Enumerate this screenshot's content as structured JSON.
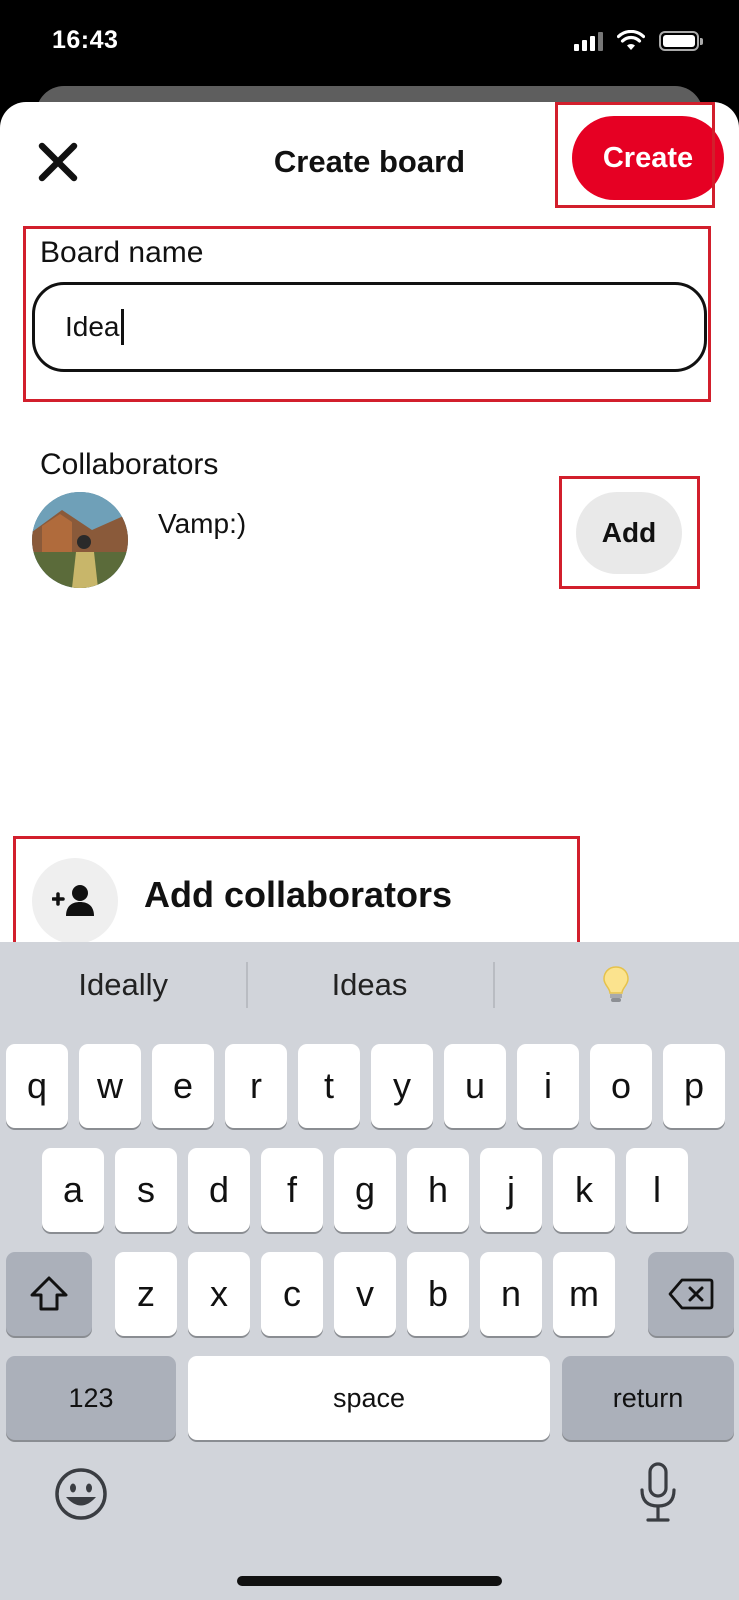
{
  "status_bar": {
    "time": "16:43"
  },
  "header": {
    "title": "Create board",
    "create_label": "Create"
  },
  "board_name": {
    "label": "Board name",
    "value": "Idea"
  },
  "collaborators": {
    "label": "Collaborators",
    "items": [
      {
        "name": "Vamp:)",
        "action_label": "Add"
      }
    ]
  },
  "add_collaborators": {
    "label": "Add collaborators"
  },
  "keyboard": {
    "suggestions": [
      "Ideally",
      "Ideas"
    ],
    "suggestion_icon": "lightbulb-icon",
    "row1": [
      "q",
      "w",
      "e",
      "r",
      "t",
      "y",
      "u",
      "i",
      "o",
      "p"
    ],
    "row2": [
      "a",
      "s",
      "d",
      "f",
      "g",
      "h",
      "j",
      "k",
      "l"
    ],
    "row3": [
      "z",
      "x",
      "c",
      "v",
      "b",
      "n",
      "m"
    ],
    "numbers_label": "123",
    "space_label": "space",
    "return_label": "return"
  },
  "colors": {
    "accent": "#e60023",
    "highlight": "#d21f2c",
    "keyboard_bg": "#d1d4da"
  }
}
